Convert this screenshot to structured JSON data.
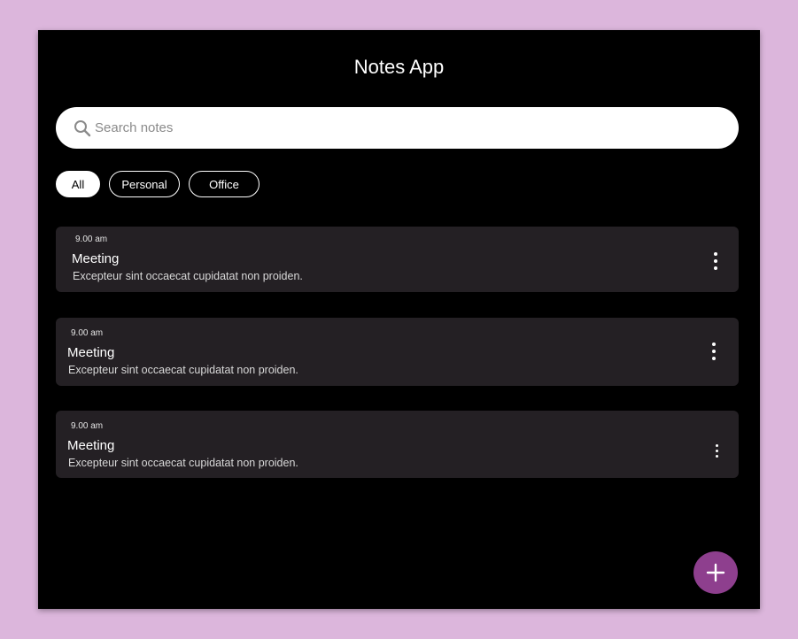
{
  "app": {
    "title": "Notes App"
  },
  "search": {
    "placeholder": "Search notes",
    "icon": "search-icon"
  },
  "filters": [
    {
      "label": "All",
      "active": true
    },
    {
      "label": "Personal",
      "active": false
    },
    {
      "label": "Office",
      "active": false
    }
  ],
  "notes": [
    {
      "time": "9.00 am",
      "title": "Meeting",
      "body": "Excepteur sint occaecat cupidatat non proiden."
    },
    {
      "time": "9.00 am",
      "title": "Meeting",
      "body": "Excepteur sint occaecat cupidatat non proiden."
    },
    {
      "time": "9.00 am",
      "title": "Meeting",
      "body": "Excepteur sint occaecat cupidatat non proiden."
    }
  ],
  "fab": {
    "icon": "plus-icon"
  },
  "colors": {
    "page_background": "#dcb6dc",
    "app_background": "#000000",
    "card_background": "#242024",
    "accent": "#8e3f8e"
  }
}
